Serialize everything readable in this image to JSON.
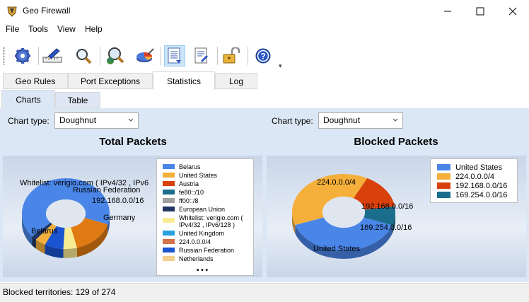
{
  "window": {
    "title": "Geo Firewall"
  },
  "menu": [
    {
      "label": "File"
    },
    {
      "label": "Tools"
    },
    {
      "label": "View"
    },
    {
      "label": "Help"
    }
  ],
  "main_tabs": [
    {
      "label": "Geo Rules"
    },
    {
      "label": "Port Exceptions"
    },
    {
      "label": "Statistics"
    },
    {
      "label": "Log"
    }
  ],
  "sub_tabs": [
    {
      "label": "Charts"
    },
    {
      "label": "Table"
    }
  ],
  "left_panel": {
    "chart_type_label": "Chart type:",
    "chart_type_value": "Doughnut",
    "title": "Total Packets",
    "legend": [
      {
        "label": "Belarus",
        "color": "#4a86e8"
      },
      {
        "label": "United States",
        "color": "#f5b03b"
      },
      {
        "label": "Austria",
        "color": "#d9410a"
      },
      {
        "label": "fe80::/10",
        "color": "#1a6e8c"
      },
      {
        "label": "ff00::/8",
        "color": "#a0a0a0"
      },
      {
        "label": "European Union",
        "color": "#1f3664"
      },
      {
        "label": "Whitelist: verigio.com (",
        "color": "#f8ec93"
      },
      {
        "label": "IPv4/32 , IPv6/128 )",
        "color": ""
      },
      {
        "label": "United Kingdom",
        "color": "#27a0e0"
      },
      {
        "label": "224.0.0.0/4",
        "color": "#d2734a"
      },
      {
        "label": "Russian Federation",
        "color": "#1a54d0"
      },
      {
        "label": "Netherlands",
        "color": "#f2cf8c"
      }
    ],
    "more": "• • •",
    "slice_labels": {
      "whitelist": "Whitelist: verigio.com ( IPv4/32 , IPv6",
      "russia": "Russian Federation",
      "overlap": "192.168.0.0/16",
      "belarus": "Belarus",
      "germany": "Germany"
    }
  },
  "right_panel": {
    "chart_type_label": "Chart type:",
    "chart_type_value": "Doughnut",
    "title": "Blocked Packets",
    "legend": [
      {
        "label": "United States",
        "color": "#4a86e8"
      },
      {
        "label": "224.0.0.0/4",
        "color": "#f5b03b"
      },
      {
        "label": "192.168.0.0/16",
        "color": "#d9410a"
      },
      {
        "label": "169.254.0.0/16",
        "color": "#1a6e8c"
      }
    ],
    "slice_labels": {
      "s224": "224.0.0.0/4",
      "s192": "192.168.0.0/16",
      "s169": "169.254.0.0/16",
      "us": "United States"
    }
  },
  "status": {
    "text": "Blocked territories: 129 of 274"
  },
  "chart_data": [
    {
      "type": "pie",
      "title": "Total Packets",
      "categories": [
        "Belarus",
        "Germany",
        "Whitelist: verigio.com ( IPv4/32 , IPv6/128 )",
        "Russian Federation",
        "United States",
        "192.168.0.0/16"
      ],
      "values": [
        66,
        16,
        5,
        7,
        4,
        2
      ]
    },
    {
      "type": "pie",
      "title": "Blocked Packets",
      "categories": [
        "United States",
        "224.0.0.0/4",
        "192.168.0.0/16",
        "169.254.0.0/16"
      ],
      "values": [
        39,
        38,
        15,
        8
      ]
    }
  ]
}
